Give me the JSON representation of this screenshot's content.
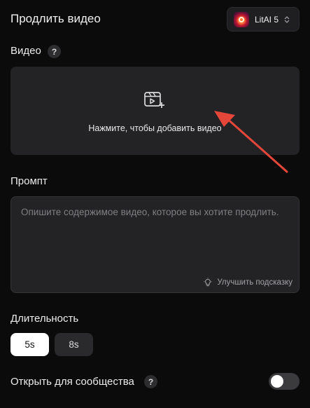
{
  "header": {
    "title": "Продлить видео",
    "model": {
      "name": "LitAI 5",
      "icon": "flame-logo-icon"
    }
  },
  "video": {
    "label": "Видео",
    "help": "?",
    "upload_text": "Нажмите, чтобы добавить видео",
    "upload_icon": "video-add-icon"
  },
  "prompt": {
    "label": "Промпт",
    "placeholder": "Опишите содержимое видео, которое вы хотите продлить.",
    "value": "",
    "improve_label": "Улучшить подсказку",
    "improve_icon": "lightbulb-icon"
  },
  "duration": {
    "label": "Длительность",
    "options": [
      "5s",
      "8s"
    ],
    "selected": "5s"
  },
  "community": {
    "label": "Открыть для сообщества",
    "help": "?",
    "enabled": false
  },
  "colors": {
    "background": "#0b0b0c",
    "panel": "#232325",
    "annotation_arrow": "#e5463a"
  }
}
